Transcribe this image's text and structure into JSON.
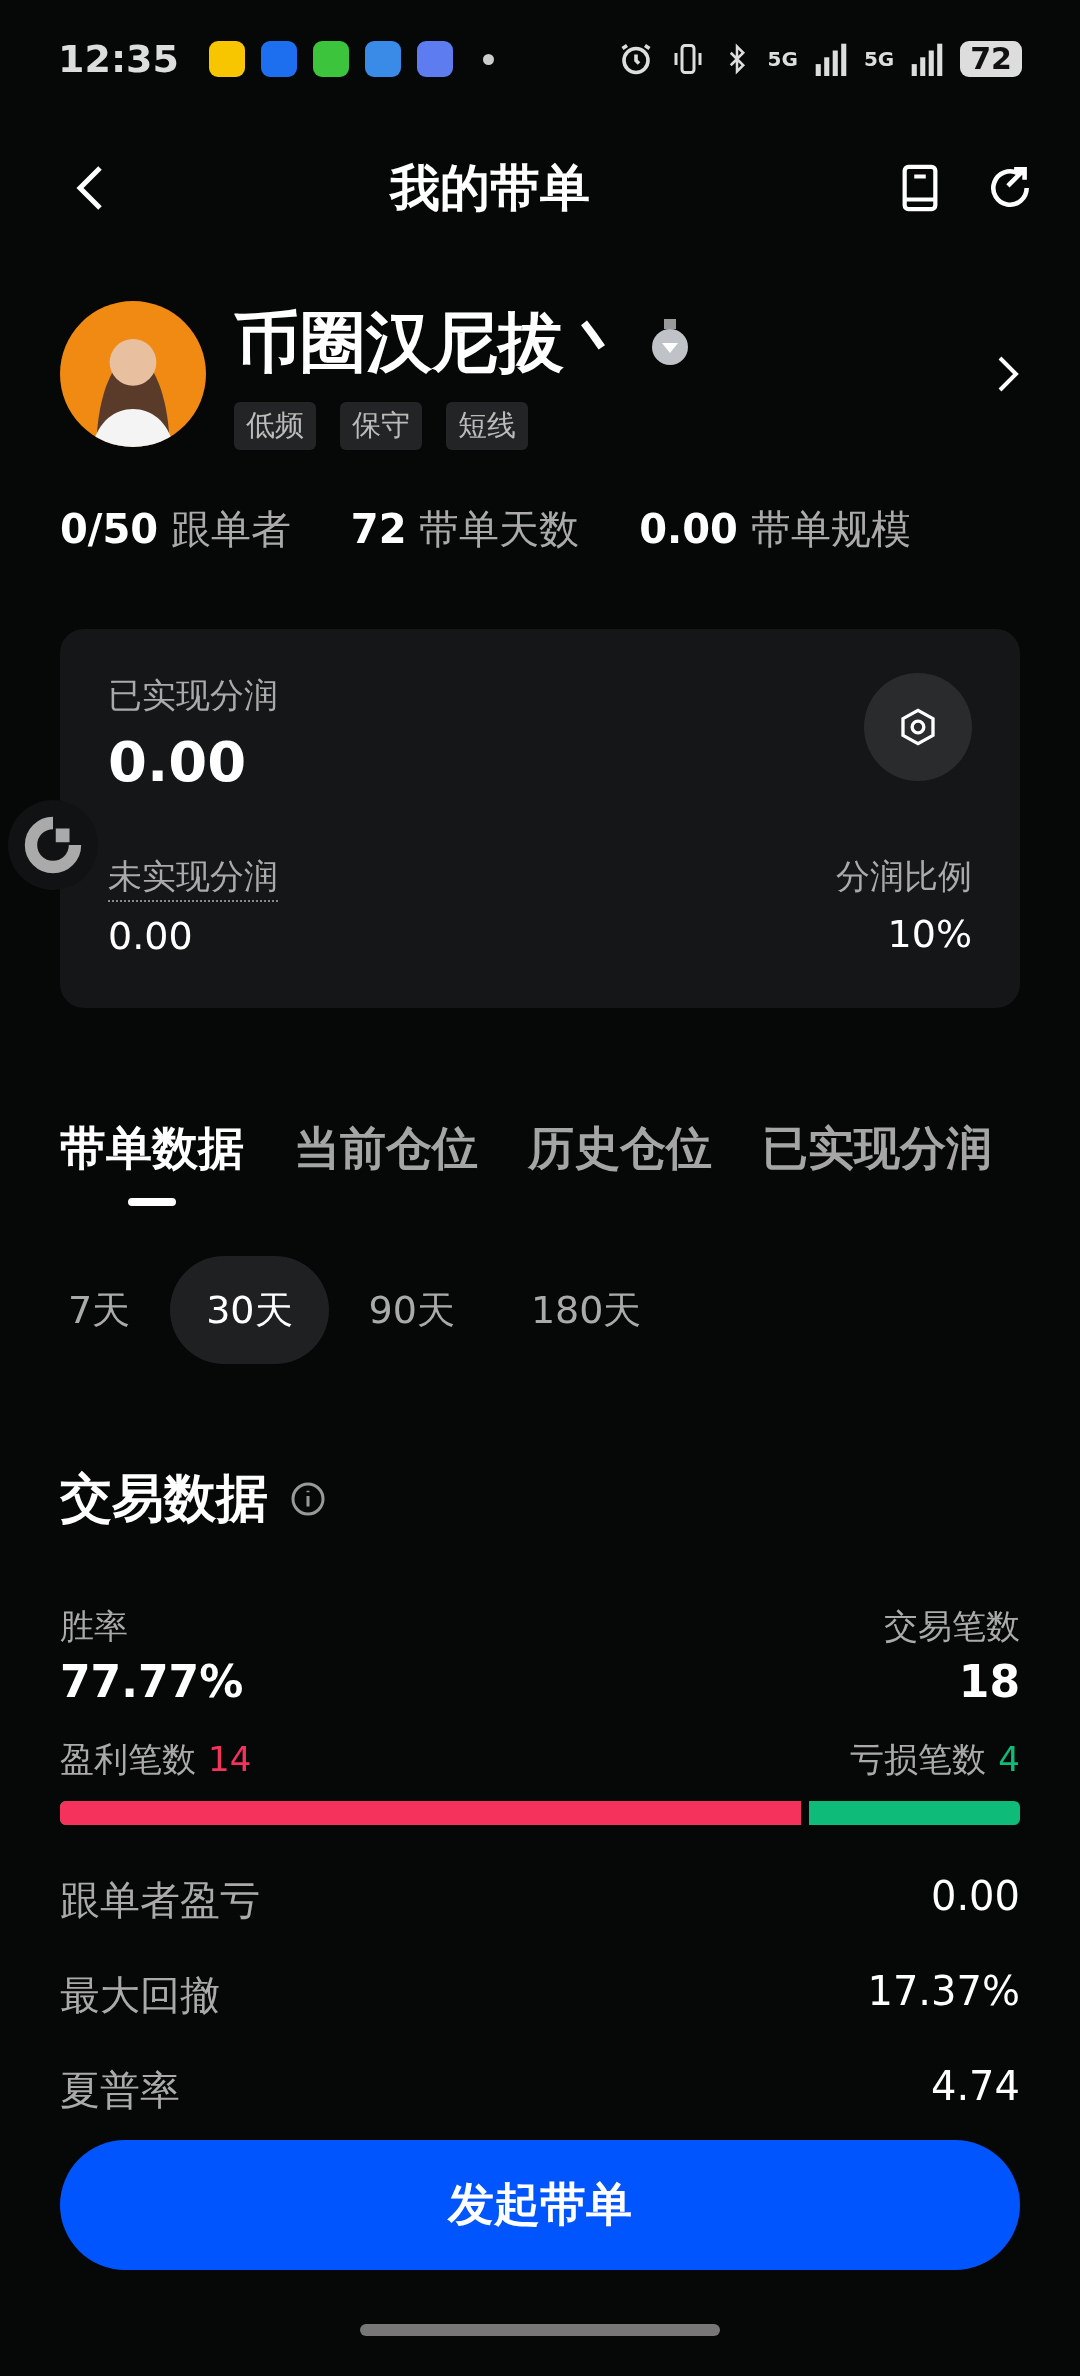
{
  "status_bar": {
    "time": "12:35",
    "signals": [
      "5G",
      "5G"
    ],
    "battery": "72"
  },
  "header": {
    "title": "我的带单"
  },
  "profile": {
    "name": "币圈汉尼拔丶",
    "tags": [
      "低频",
      "保守",
      "短线"
    ],
    "stats": [
      "**0/50** 跟单者",
      "**72** 带单天数",
      "**0.00** 带单规模"
    ]
  },
  "profit_card": {
    "realized_label": "已实现分润",
    "realized_value": "0.00",
    "unrealized_label": "未实现分润",
    "unrealized_value": "0.00",
    "ratio_label": "分润比例",
    "ratio_value": "10%"
  },
  "tabs": [
    {
      "label": "带单数据",
      "selected": true
    },
    {
      "label": "当前仓位",
      "selected": false
    },
    {
      "label": "历史仓位",
      "selected": false
    },
    {
      "label": "已实现分润",
      "selected": false
    }
  ],
  "periods": [
    {
      "label": "7天",
      "selected": false
    },
    {
      "label": "30天",
      "selected": true
    },
    {
      "label": "90天",
      "selected": false
    },
    {
      "label": "180天",
      "selected": false
    }
  ],
  "trade_data": {
    "title": "交易数据",
    "win_rate_label": "胜率",
    "win_rate": "77.77%",
    "trades_label": "交易笔数",
    "trades": "18",
    "win_label": "盈利笔数",
    "win_count": "14",
    "loss_label": "亏损笔数",
    "loss_count": "4",
    "win_bar": {
      "level": 0.78
    },
    "rows": [
      {
        "label": "跟单者盈亏",
        "value": "0.00"
      },
      {
        "label": "最大回撤",
        "value": "17.37%"
      },
      {
        "label": "夏普率",
        "value": "4.74"
      }
    ]
  },
  "action_button": "发起带单"
}
